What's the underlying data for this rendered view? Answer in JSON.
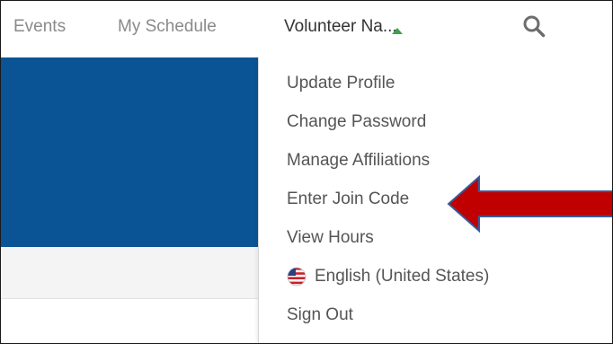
{
  "nav": {
    "events": "Events",
    "schedule": "My Schedule",
    "user": "Volunteer Na..."
  },
  "icons": {
    "caret": "caret-up-icon",
    "search": "search-icon",
    "flag": "us-flag-icon",
    "arrow": "red-arrow-pointer"
  },
  "menu": {
    "items": [
      "Update Profile",
      "Change Password",
      "Manage Affiliations",
      "Enter Join Code",
      "View Hours",
      "English (United States)",
      "Sign Out"
    ]
  },
  "colors": {
    "hero": "#0a5495",
    "caret": "#3aa24a",
    "arrow": "#c00000"
  }
}
